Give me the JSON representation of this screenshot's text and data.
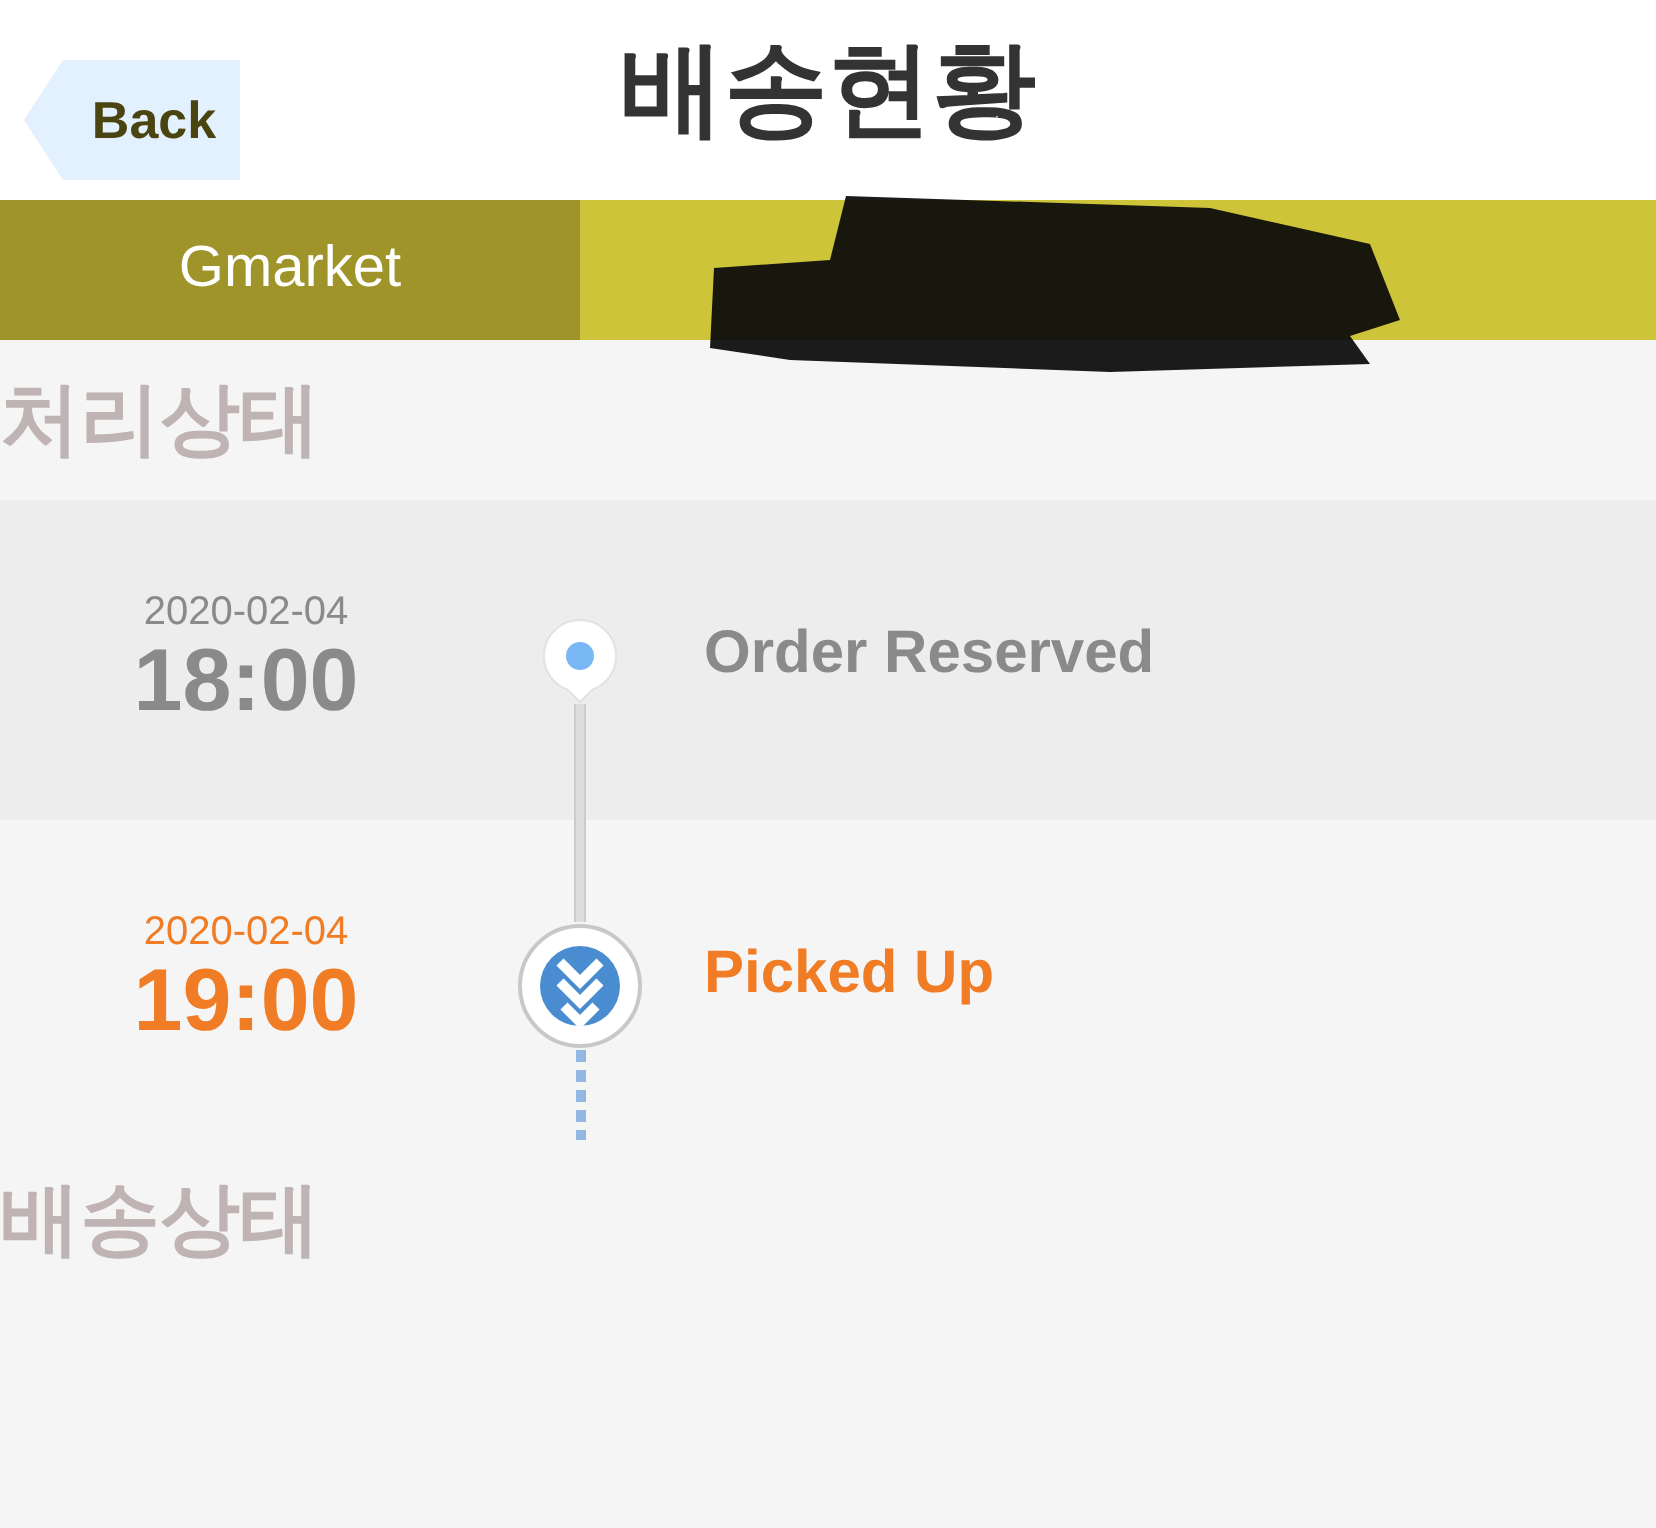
{
  "header": {
    "back_label": "Back",
    "title": "배송현황"
  },
  "carrier": {
    "name": "Gmarket"
  },
  "sections": [
    {
      "title": "처리상태"
    },
    {
      "title": "배송상태"
    }
  ],
  "events": [
    {
      "date": "2020-02-04",
      "time": "18:00",
      "status": "Order Reserved",
      "current": false
    },
    {
      "date": "2020-02-04",
      "time": "19:00",
      "status": "Picked Up",
      "current": true
    }
  ]
}
